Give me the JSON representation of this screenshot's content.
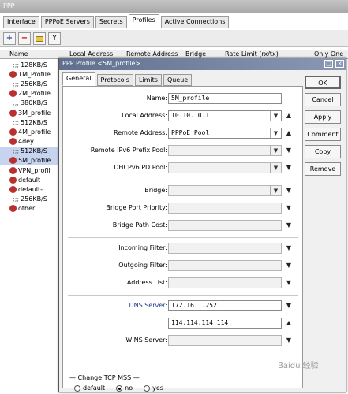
{
  "window": {
    "title": "PPP"
  },
  "tabs": [
    "Interface",
    "PPPoE Servers",
    "Secrets",
    "Profiles",
    "Active Connections"
  ],
  "toolbar": {
    "add": "+",
    "remove": "−",
    "copy": "",
    "filter": "Y"
  },
  "list": {
    "columns": {
      "name": "Name",
      "local": "Local Address",
      "remote": "Remote Address",
      "bridge": "Bridge",
      "rate": "Rate Limit (rx/tx)",
      "only": "Only One"
    },
    "rows": [
      {
        "kind": "comment",
        "text": "128KB/S"
      },
      {
        "kind": "item",
        "text": "1M_Profile"
      },
      {
        "kind": "comment",
        "text": "256KB/S"
      },
      {
        "kind": "item",
        "text": "2M_Profile"
      },
      {
        "kind": "comment",
        "text": "380KB/S"
      },
      {
        "kind": "item",
        "text": "3M_profile"
      },
      {
        "kind": "comment",
        "text": "512KB/S"
      },
      {
        "kind": "item",
        "text": "4M_profile"
      },
      {
        "kind": "item",
        "text": "4dey"
      },
      {
        "kind": "comment",
        "text": "512KB/S",
        "selected": true
      },
      {
        "kind": "item",
        "text": "5M_profile",
        "selected": true
      },
      {
        "kind": "item",
        "text": "VPN_profil"
      },
      {
        "kind": "item",
        "text": "default"
      },
      {
        "kind": "item",
        "text": "default-..."
      },
      {
        "kind": "comment",
        "text": "256KB/S"
      },
      {
        "kind": "item",
        "text": "other"
      }
    ]
  },
  "dialog": {
    "title": "PPP Profile <5M_profile>",
    "tabs": [
      "General",
      "Protocols",
      "Limits",
      "Queue"
    ],
    "fields": {
      "name": {
        "label": "Name:",
        "value": "5M_profile"
      },
      "local_address": {
        "label": "Local Address:",
        "value": "10.10.10.1"
      },
      "remote_address": {
        "label": "Remote Address:",
        "value": "PPPoE_Pool"
      },
      "remote_ipv6": {
        "label": "Remote IPv6 Prefix Pool:",
        "value": ""
      },
      "dhcpv6": {
        "label": "DHCPv6 PD Pool:",
        "value": ""
      },
      "bridge": {
        "label": "Bridge:",
        "value": ""
      },
      "bridge_port_priority": {
        "label": "Bridge Port Priority:",
        "value": ""
      },
      "bridge_path_cost": {
        "label": "Bridge Path Cost:",
        "value": ""
      },
      "incoming_filter": {
        "label": "Incoming Filter:",
        "value": ""
      },
      "outgoing_filter": {
        "label": "Outgoing Filter:",
        "value": ""
      },
      "address_list": {
        "label": "Address List:",
        "value": ""
      },
      "dns_server": {
        "label": "DNS Server:",
        "value": "172.16.1.252"
      },
      "dns_server_2": {
        "label": "",
        "value": "114.114.114.114"
      },
      "wins_server": {
        "label": "WINS Server:",
        "value": ""
      }
    },
    "mss": {
      "label": "Change TCP MSS",
      "options": [
        "default",
        "no",
        "yes"
      ],
      "selected": "no"
    },
    "buttons": [
      "OK",
      "Cancel",
      "Apply",
      "Comment",
      "Copy",
      "Remove"
    ]
  },
  "watermark": "Baidu 经验"
}
